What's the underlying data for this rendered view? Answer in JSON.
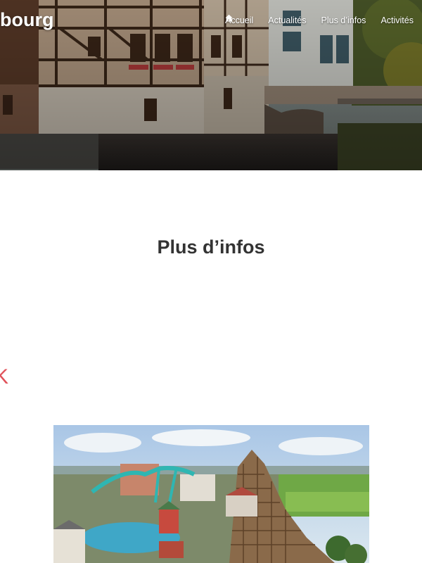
{
  "header": {
    "brand": "bourg",
    "nav": [
      {
        "label": "Accueil",
        "icon": "home-icon"
      },
      {
        "label": "Actualités"
      },
      {
        "label": "Plus d’infos"
      },
      {
        "label": "Activités"
      }
    ]
  },
  "main": {
    "page_title": "Plus d’infos",
    "partial_glyph": "K"
  },
  "colors": {
    "accent": "#e0525a",
    "title_text": "#333333",
    "nav_text": "#ffffff"
  }
}
